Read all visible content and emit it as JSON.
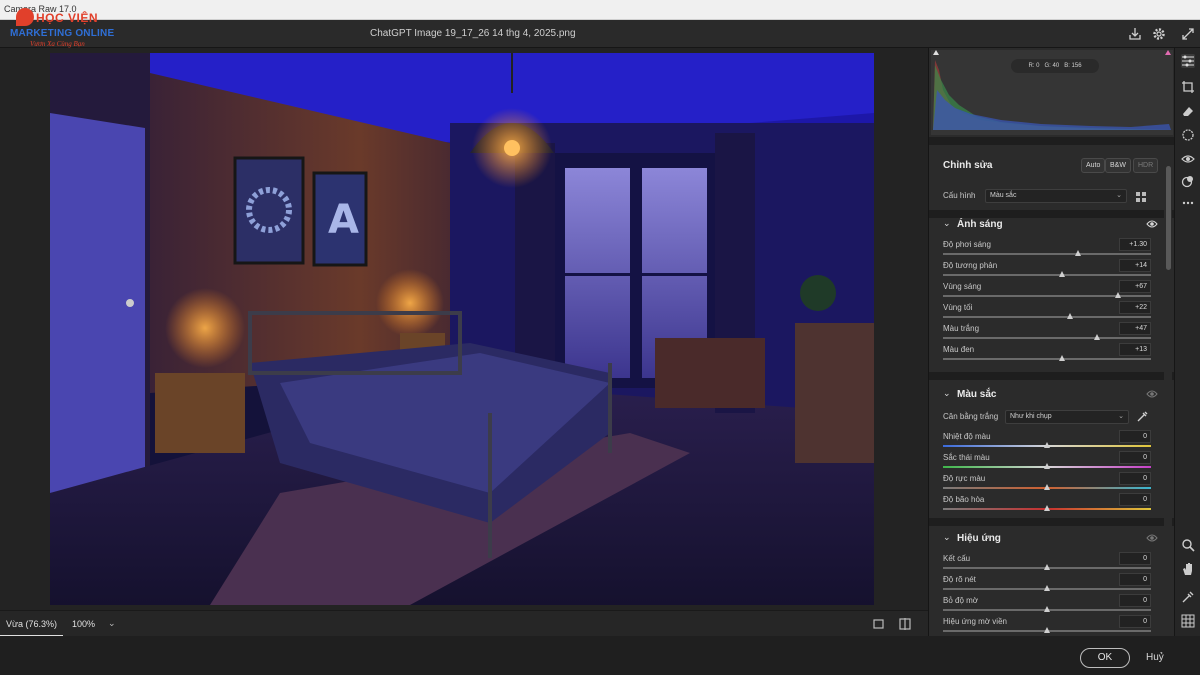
{
  "app": {
    "title": "Camera Raw 17.0"
  },
  "logo": {
    "line1": "HỌC VIỆN",
    "line2": "MARKETING ONLINE",
    "line3": "Vươn Xa Cùng Bạn"
  },
  "header": {
    "file_name": "ChatGPT Image 19_17_26 14 thg 4, 2025.png",
    "icons": [
      "download-icon",
      "gear-icon",
      "expand-icon"
    ]
  },
  "histogram": {
    "readout": {
      "r": "R: 0",
      "g": "G: 40",
      "b": "B: 156"
    }
  },
  "edit": {
    "title": "Chỉnh sửa",
    "buttons": {
      "auto": "Auto",
      "bw": "B&W",
      "hdr": "HDR"
    },
    "profile_label": "Cấu hình",
    "profile_value": "Màu sắc"
  },
  "light": {
    "title": "Ánh sáng",
    "sliders": [
      {
        "label": "Độ phơi sáng",
        "value": "+1.30",
        "level": 0.65
      },
      {
        "label": "Độ tương phản",
        "value": "+14",
        "level": 0.57
      },
      {
        "label": "Vùng sáng",
        "value": "+67",
        "level": 0.84
      },
      {
        "label": "Vùng tối",
        "value": "+22",
        "level": 0.61
      },
      {
        "label": "Màu trắng",
        "value": "+47",
        "level": 0.74
      },
      {
        "label": "Màu đen",
        "value": "+13",
        "level": 0.57
      }
    ]
  },
  "color": {
    "title": "Màu sắc",
    "wb_label": "Cân bằng trắng",
    "wb_value": "Như khi chụp",
    "sliders": [
      {
        "label": "Nhiệt độ màu",
        "value": "0",
        "level": 0.5
      },
      {
        "label": "Sắc thái màu",
        "value": "0",
        "level": 0.5
      },
      {
        "label": "Độ rực màu",
        "value": "0",
        "level": 0.5
      },
      {
        "label": "Độ bão hòa",
        "value": "0",
        "level": 0.5
      }
    ]
  },
  "effects": {
    "title": "Hiệu ứng",
    "sliders": [
      {
        "label": "Kết cấu",
        "value": "0",
        "level": 0.5
      },
      {
        "label": "Độ rõ nét",
        "value": "0",
        "level": 0.5
      },
      {
        "label": "Bỏ độ mờ",
        "value": "0",
        "level": 0.5
      },
      {
        "label": "Hiệu ứng mờ viền",
        "value": "0",
        "level": 0.5
      }
    ]
  },
  "zoom": {
    "fit_label": "Vừa (76.3%)",
    "percent": "100%"
  },
  "footer": {
    "ok": "OK",
    "cancel": "Huỷ"
  },
  "colors": {
    "panel_bg": "#2b2b2b",
    "accent": "#e1402b",
    "logo_blue": "#2f6fd6"
  }
}
